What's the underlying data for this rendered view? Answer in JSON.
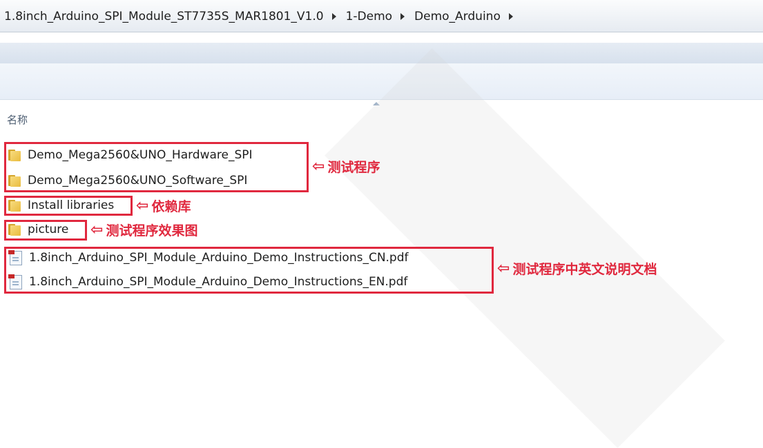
{
  "breadcrumb": [
    "1.8inch_Arduino_SPI_Module_ST7735S_MAR1801_V1.0",
    "1-Demo",
    "Demo_Arduino"
  ],
  "column_header": "名称",
  "files": [
    {
      "name": "Demo_Mega2560&UNO_Hardware_SPI",
      "type": "folder"
    },
    {
      "name": "Demo_Mega2560&UNO_Software_SPI",
      "type": "folder"
    },
    {
      "name": "Install libraries",
      "type": "folder"
    },
    {
      "name": "picture",
      "type": "folder"
    },
    {
      "name": "1.8inch_Arduino_SPI_Module_Arduino_Demo_Instructions_CN.pdf",
      "type": "pdf"
    },
    {
      "name": "1.8inch_Arduino_SPI_Module_Arduino_Demo_Instructions_EN.pdf",
      "type": "pdf"
    }
  ],
  "annotations": {
    "demos": "测试程序",
    "libraries": "依赖库",
    "picture": "测试程序效果图",
    "docs": "测试程序中英文说明文档",
    "arrow": "⇦"
  },
  "colors": {
    "annotation": "#e0283e",
    "folder": "#e9bb3e"
  }
}
